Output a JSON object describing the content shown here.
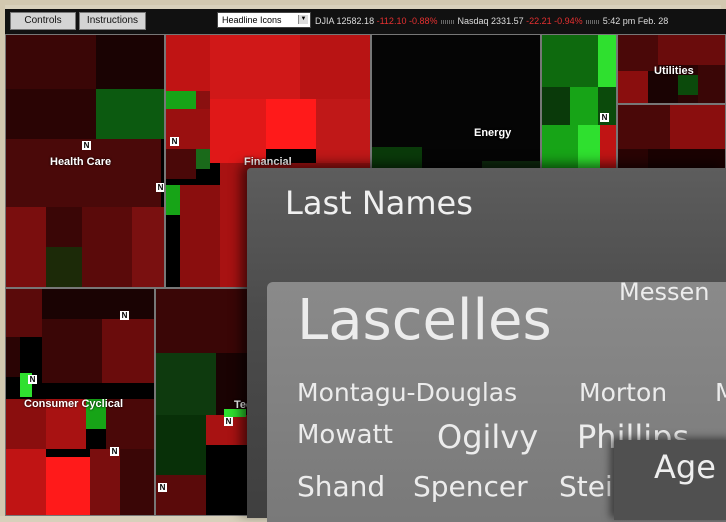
{
  "toolbar": {
    "controls_label": "Controls",
    "instructions_label": "Instructions",
    "view_select_value": "Headline Icons",
    "djia_label": "DJIA",
    "djia_value": "12582.18",
    "djia_change": "-112.10",
    "djia_pct": "-0.88%",
    "nasdaq_label": "Nasdaq",
    "nasdaq_value": "2331.57",
    "nasdaq_change": "-22.21",
    "nasdaq_pct": "-0.94%",
    "timestamp": "5:42 pm  Feb. 28"
  },
  "sectors": {
    "health_care": "Health Care",
    "financial": "Financial",
    "energy": "Energy",
    "utilities": "Utilities",
    "consumer_cyclical": "Consumer Cyclical",
    "technology_partial": "Tec"
  },
  "badge_letter": "N",
  "last_names_panel": {
    "title": "Last Names",
    "names": {
      "lascelles": "Lascelles",
      "messenger": "Messen",
      "montagu": "Montagu-Douglas",
      "morton": "Morton",
      "m_trunc": "M",
      "mowatt": "Mowatt",
      "ogilvy": "Ogilvy",
      "phillips": "Phillips",
      "shand": "Shand",
      "spencer": "Spencer",
      "stei": "Stei"
    }
  },
  "age_panel": {
    "title": "Age I"
  },
  "colors": {
    "dark_red": "#4a0a0a",
    "red": "#c81818",
    "bright_red": "#ff1a1a",
    "dark_green": "#0b4a0b",
    "green": "#17a417",
    "bright_green": "#2fe02f"
  }
}
